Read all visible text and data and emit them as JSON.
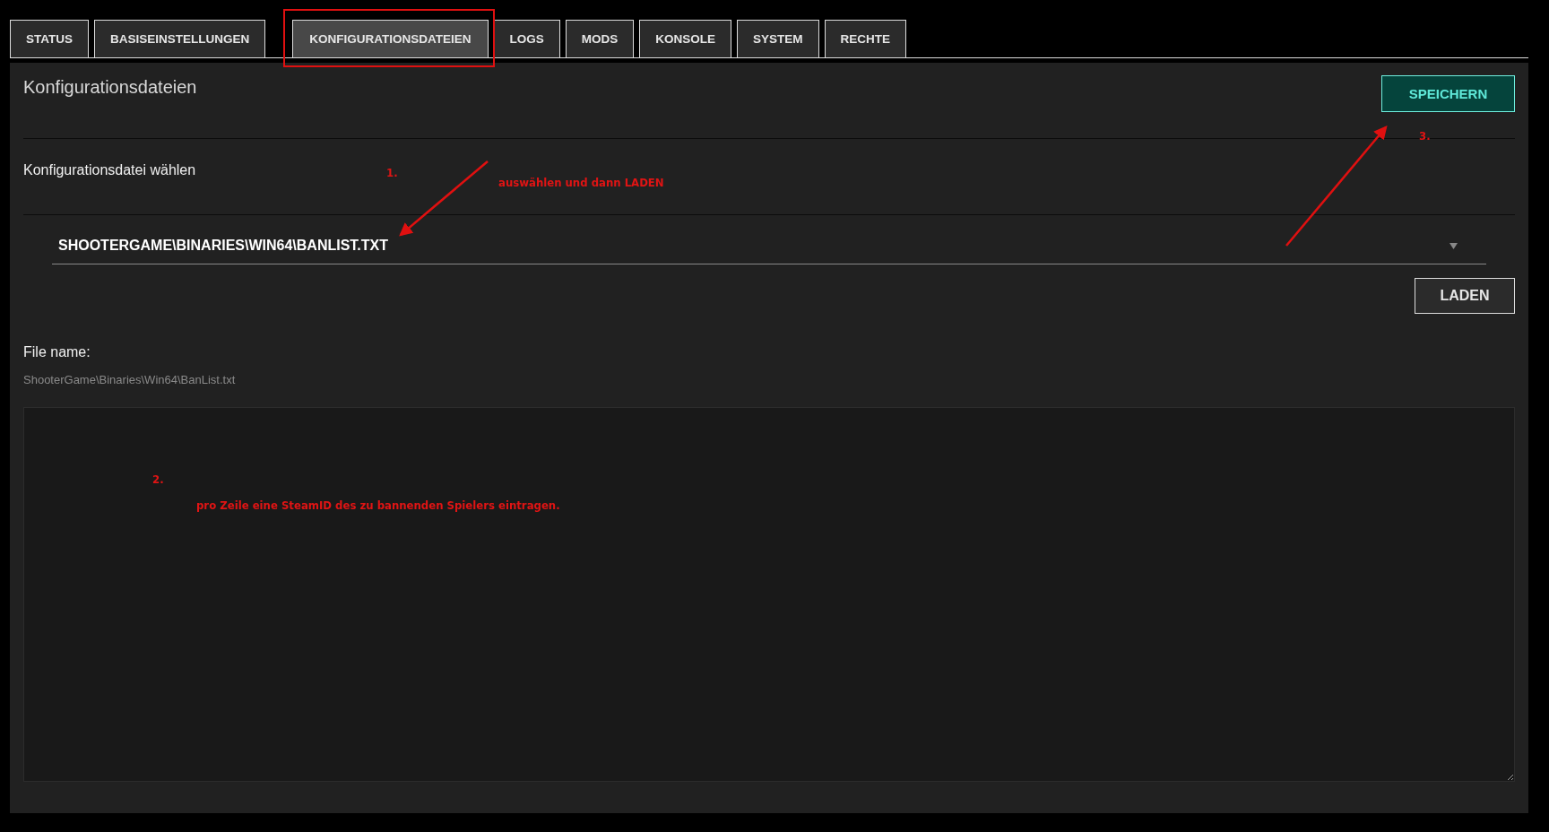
{
  "tabs": [
    {
      "label": "STATUS",
      "selected": false
    },
    {
      "label": "BASISEINSTELLUNGEN",
      "selected": false
    },
    {
      "label": "KONFIGURATIONSDATEIEN",
      "selected": true
    },
    {
      "label": "LOGS",
      "selected": false
    },
    {
      "label": "MODS",
      "selected": false
    },
    {
      "label": "KONSOLE",
      "selected": false
    },
    {
      "label": "SYSTEM",
      "selected": false
    },
    {
      "label": "RECHTE",
      "selected": false
    }
  ],
  "panel": {
    "title": "Konfigurationsdateien",
    "save_button": "SPEICHERN",
    "select_label": "Konfigurationsdatei wählen",
    "select_value": "SHOOTERGAME\\BINARIES\\WIN64\\BANLIST.TXT",
    "load_button": "LADEN",
    "file_name_label": "File name:",
    "file_name": "ShooterGame\\Binaries\\Win64\\BanList.txt"
  },
  "annotations": [
    {
      "text": "1."
    },
    {
      "text": "auswählen und dann LADEN"
    },
    {
      "text": "3."
    },
    {
      "text": "2."
    },
    {
      "text": "pro Zeile eine SteamID des zu bannenden Spielers eintragen."
    }
  ]
}
